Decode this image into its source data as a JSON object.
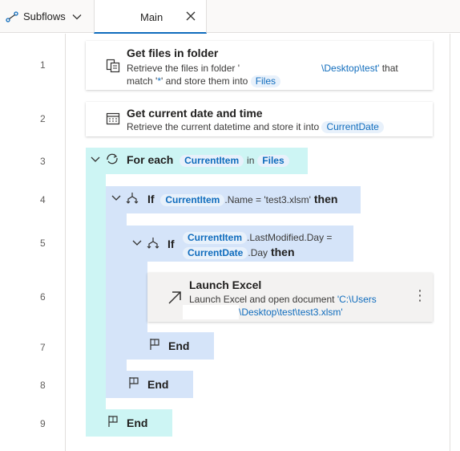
{
  "tabs": {
    "subflows_label": "Subflows",
    "main_label": "Main"
  },
  "line_numbers": [
    "1",
    "2",
    "3",
    "4",
    "5",
    "6",
    "7",
    "8",
    "9"
  ],
  "actions": {
    "get_files": {
      "title": "Get files in folder",
      "desc_prefix": "Retrieve the files in folder '",
      "desc_path": "\\Desktop\\test'",
      "desc_after": " that",
      "desc_line2_a": "match '",
      "desc_line2_pattern": "*",
      "desc_line2_b": "' and store them into",
      "var": "Files"
    },
    "get_date": {
      "title": "Get current date and time",
      "desc": "Retrieve the current datetime and store it into",
      "var": "CurrentDate"
    },
    "for_each": {
      "keyword": "For each",
      "item_var": "CurrentItem",
      "in": "in",
      "list_var": "Files"
    },
    "if1": {
      "keyword": "If",
      "var": "CurrentItem",
      "cond": ".Name = 'test3.xlsm'",
      "then": "then"
    },
    "if2": {
      "keyword": "If",
      "var1": "CurrentItem",
      "cond1": ".LastModified.Day =",
      "var2": "CurrentDate",
      "cond2": ".Day",
      "then": "then"
    },
    "launch_excel": {
      "title": "Launch Excel",
      "desc_prefix": "Launch Excel and open document",
      "desc_path1": "'C:\\Users",
      "desc_path2": "\\Desktop\\test\\test3.xlsm'"
    },
    "end_label": "End"
  },
  "colors": {
    "foreach_bg": "#cdf5f4",
    "if_bg": "#d5e4f9",
    "accent": "#0f6cbd"
  }
}
